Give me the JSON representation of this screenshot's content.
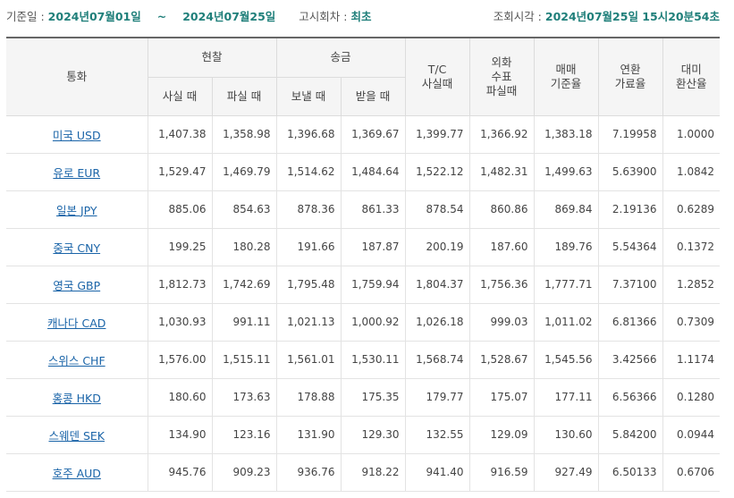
{
  "info": {
    "base_date_label": "기준일 :",
    "start_date": "2024년07월01일",
    "tilde": "~",
    "end_date": "2024년07월25일",
    "notice_label": "고시회차 :",
    "notice_value": "최초",
    "query_time_label": "조회시각 :",
    "query_time_value": "2024년07월25일 15시20분54초"
  },
  "headers": {
    "currency": "통화",
    "cash": "현찰",
    "remit": "송금",
    "tc_line1": "T/C",
    "tc_line2": "사실때",
    "check_line1": "외화",
    "check_line2": "수표",
    "check_line3": "파실때",
    "base_line1": "매매",
    "base_line2": "기준율",
    "conv_line1": "연환",
    "conv_line2": "가료율",
    "usd_line1": "대미",
    "usd_line2": "환산율",
    "cash_buy": "사실 때",
    "cash_sell": "파실 때",
    "remit_send": "보낼 때",
    "remit_receive": "받을 때"
  },
  "rows": [
    {
      "currency": "미국 USD",
      "cash_buy": "1,407.38",
      "cash_sell": "1,358.98",
      "remit_send": "1,396.68",
      "remit_receive": "1,369.67",
      "tc_buy": "1,399.77",
      "check_sell": "1,366.92",
      "base_rate": "1,383.18",
      "conversion_rate": "7.19958",
      "usd_rate": "1.0000"
    },
    {
      "currency": "유로 EUR",
      "cash_buy": "1,529.47",
      "cash_sell": "1,469.79",
      "remit_send": "1,514.62",
      "remit_receive": "1,484.64",
      "tc_buy": "1,522.12",
      "check_sell": "1,482.31",
      "base_rate": "1,499.63",
      "conversion_rate": "5.63900",
      "usd_rate": "1.0842"
    },
    {
      "currency": "일본 JPY",
      "cash_buy": "885.06",
      "cash_sell": "854.63",
      "remit_send": "878.36",
      "remit_receive": "861.33",
      "tc_buy": "878.54",
      "check_sell": "860.86",
      "base_rate": "869.84",
      "conversion_rate": "2.19136",
      "usd_rate": "0.6289"
    },
    {
      "currency": "중국 CNY",
      "cash_buy": "199.25",
      "cash_sell": "180.28",
      "remit_send": "191.66",
      "remit_receive": "187.87",
      "tc_buy": "200.19",
      "check_sell": "187.60",
      "base_rate": "189.76",
      "conversion_rate": "5.54364",
      "usd_rate": "0.1372"
    },
    {
      "currency": "영국 GBP",
      "cash_buy": "1,812.73",
      "cash_sell": "1,742.69",
      "remit_send": "1,795.48",
      "remit_receive": "1,759.94",
      "tc_buy": "1,804.37",
      "check_sell": "1,756.36",
      "base_rate": "1,777.71",
      "conversion_rate": "7.37100",
      "usd_rate": "1.2852"
    },
    {
      "currency": "캐나다 CAD",
      "cash_buy": "1,030.93",
      "cash_sell": "991.11",
      "remit_send": "1,021.13",
      "remit_receive": "1,000.92",
      "tc_buy": "1,026.18",
      "check_sell": "999.03",
      "base_rate": "1,011.02",
      "conversion_rate": "6.81366",
      "usd_rate": "0.7309"
    },
    {
      "currency": "스위스 CHF",
      "cash_buy": "1,576.00",
      "cash_sell": "1,515.11",
      "remit_send": "1,561.01",
      "remit_receive": "1,530.11",
      "tc_buy": "1,568.74",
      "check_sell": "1,528.67",
      "base_rate": "1,545.56",
      "conversion_rate": "3.42566",
      "usd_rate": "1.1174"
    },
    {
      "currency": "홍콩 HKD",
      "cash_buy": "180.60",
      "cash_sell": "173.63",
      "remit_send": "178.88",
      "remit_receive": "175.35",
      "tc_buy": "179.77",
      "check_sell": "175.07",
      "base_rate": "177.11",
      "conversion_rate": "6.56366",
      "usd_rate": "0.1280"
    },
    {
      "currency": "스웨덴 SEK",
      "cash_buy": "134.90",
      "cash_sell": "123.16",
      "remit_send": "131.90",
      "remit_receive": "129.30",
      "tc_buy": "132.55",
      "check_sell": "129.09",
      "base_rate": "130.60",
      "conversion_rate": "5.84200",
      "usd_rate": "0.0944"
    },
    {
      "currency": "호주 AUD",
      "cash_buy": "945.76",
      "cash_sell": "909.23",
      "remit_send": "936.76",
      "remit_receive": "918.22",
      "tc_buy": "941.40",
      "check_sell": "916.59",
      "base_rate": "927.49",
      "conversion_rate": "6.50133",
      "usd_rate": "0.6706"
    }
  ]
}
